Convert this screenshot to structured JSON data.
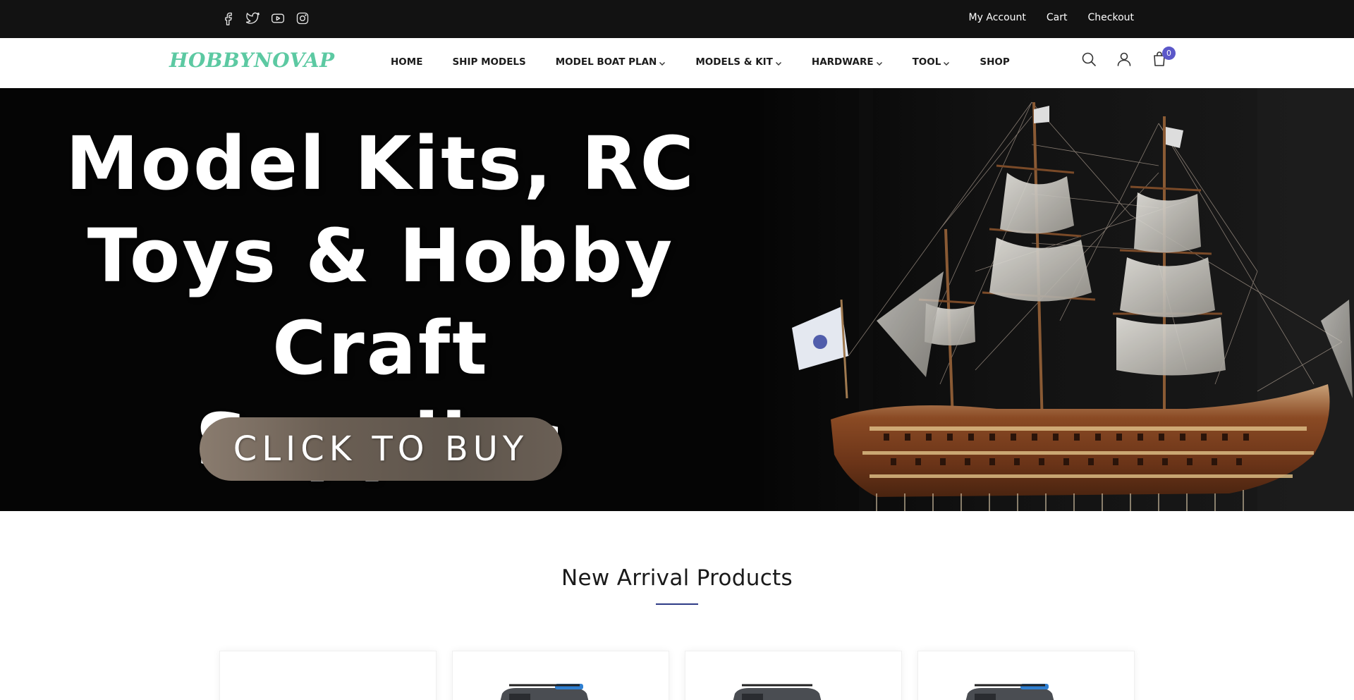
{
  "topbar": {
    "social_icons": [
      "facebook-icon",
      "twitter-icon",
      "youtube-icon",
      "instagram-icon"
    ],
    "links": [
      "My Account",
      "Cart",
      "Checkout"
    ]
  },
  "header": {
    "logo": "HOBBYNOVAP",
    "nav": [
      {
        "label": "HOME",
        "dropdown": false
      },
      {
        "label": "SHIP MODELS",
        "dropdown": false
      },
      {
        "label": "MODEL BOAT PLAN",
        "dropdown": true
      },
      {
        "label": "MODELS & KIT",
        "dropdown": true
      },
      {
        "label": "HARDWARE",
        "dropdown": true
      },
      {
        "label": "TOOL",
        "dropdown": true
      },
      {
        "label": "SHOP",
        "dropdown": false
      }
    ],
    "icons": [
      "search-icon",
      "user-icon",
      "shopping-bag-icon"
    ],
    "cart_count": "0"
  },
  "hero": {
    "lines": [
      "Model Kits, RC",
      "Toys & Hobby Craft",
      "Supplies"
    ],
    "button": "CLICK TO BUY"
  },
  "section": {
    "title": "New Arrival Products"
  },
  "colors": {
    "topbar_bg": "#121212",
    "logo": "#5cc9a2",
    "accent": "#5b58c9",
    "underline": "#2e3a86"
  }
}
